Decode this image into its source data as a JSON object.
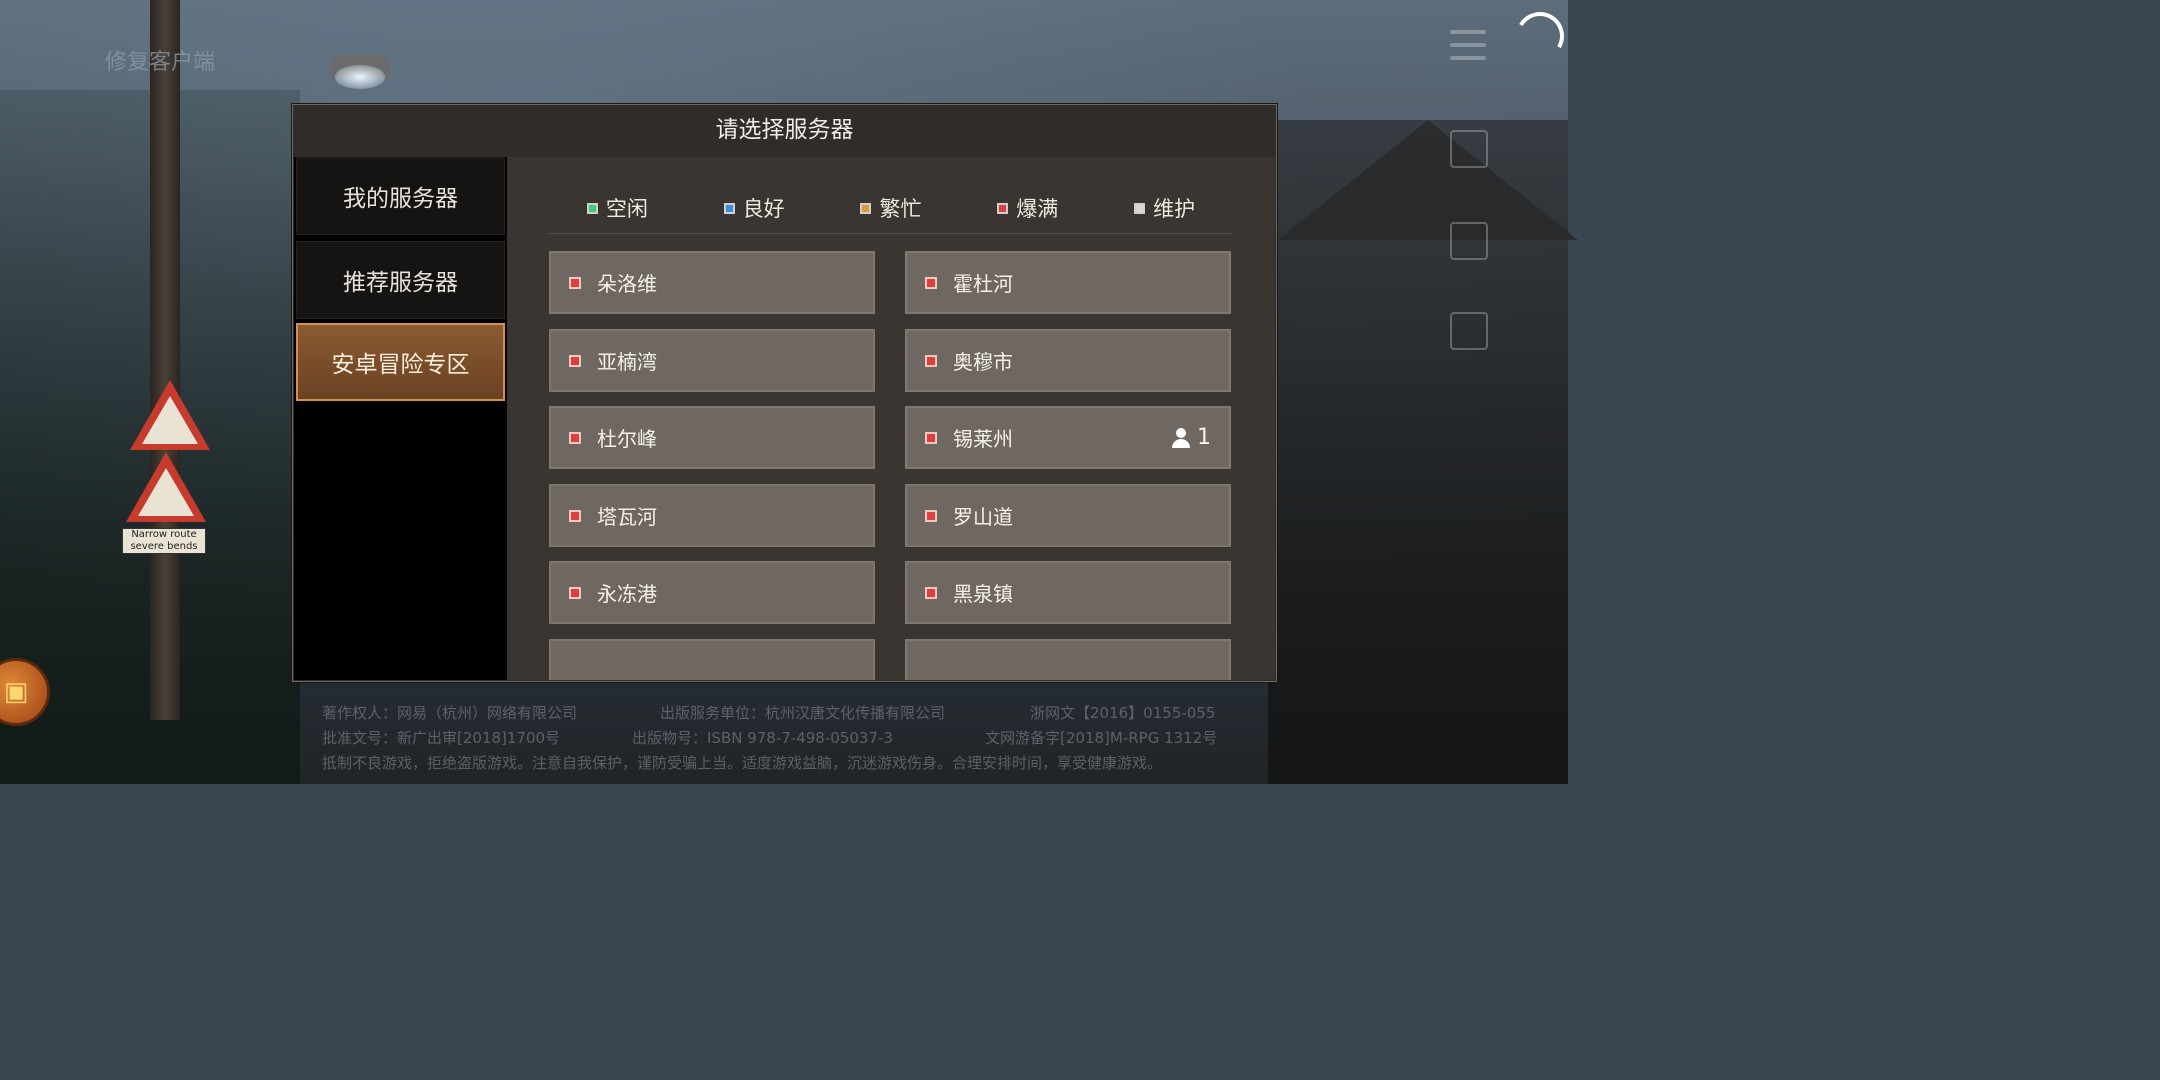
{
  "background": {
    "corner_label": "修复客户端",
    "sign_text": "Narrow route severe bends"
  },
  "dialog": {
    "title": "请选择服务器"
  },
  "tabs": [
    {
      "label": "我的服务器",
      "active": false
    },
    {
      "label": "推荐服务器",
      "active": false
    },
    {
      "label": "安卓冒险专区",
      "active": true
    }
  ],
  "legend": [
    {
      "label": "空闲",
      "color": "#3fcf7a"
    },
    {
      "label": "良好",
      "color": "#3a8ee0"
    },
    {
      "label": "繁忙",
      "color": "#d99a3a"
    },
    {
      "label": "爆满",
      "color": "#dd4040"
    },
    {
      "label": "维护",
      "color": "#d8d8d8"
    }
  ],
  "servers": [
    {
      "name": "朵洛维",
      "status": "爆满"
    },
    {
      "name": "霍杜河",
      "status": "爆满"
    },
    {
      "name": "亚楠湾",
      "status": "爆满"
    },
    {
      "name": "奥穆市",
      "status": "爆满"
    },
    {
      "name": "杜尔峰",
      "status": "爆满"
    },
    {
      "name": "锡莱州",
      "status": "爆满",
      "characters": "1"
    },
    {
      "name": "塔瓦河",
      "status": "爆满"
    },
    {
      "name": "罗山道",
      "status": "爆满"
    },
    {
      "name": "永冻港",
      "status": "爆满"
    },
    {
      "name": "黑泉镇",
      "status": "爆满"
    }
  ],
  "footer": {
    "copyright": "著作权人：网易（杭州）网络有限公司",
    "publisher": "出版服务单位：杭州汉唐文化传播有限公司",
    "culture_no": "浙网文【2016】0155-055",
    "approval": "批准文号：新广出审[2018]1700号",
    "isbn": "出版物号：ISBN 978-7-498-05037-3",
    "record": "文网游备字[2018]M-RPG 1312号",
    "health_notice": "抵制不良游戏，拒绝盗版游戏。注意自我保护，谨防受骗上当。适度游戏益脑，沉迷游戏伤身。合理安排时间，享受健康游戏。"
  }
}
